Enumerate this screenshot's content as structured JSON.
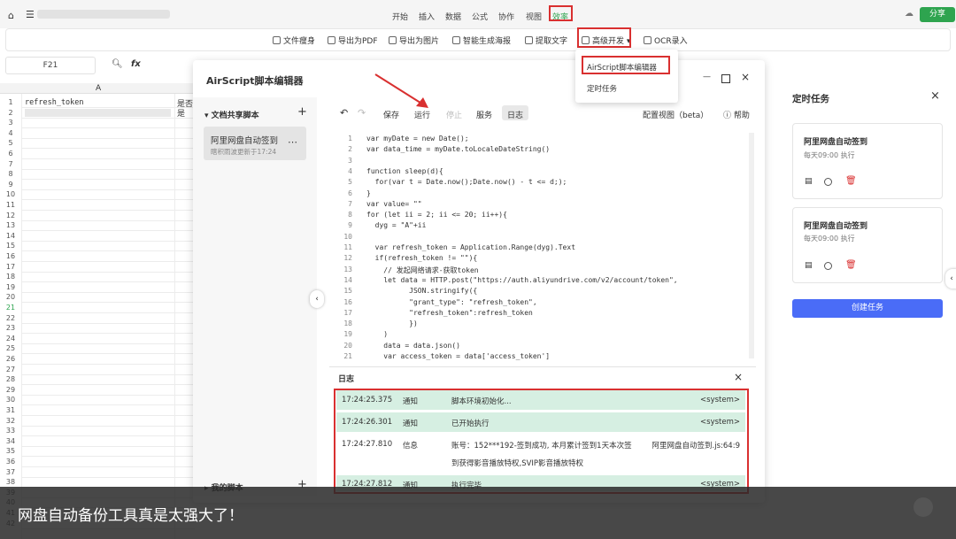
{
  "topbar": {
    "menus": [
      "开始",
      "插入",
      "数据",
      "公式",
      "协作",
      "视图",
      "效率"
    ],
    "share_label": "分享"
  },
  "toolbar": {
    "items": [
      "文件瘦身",
      "导出为PDF",
      "导出为图片",
      "智能生成海报",
      "提取文字",
      "高级开发",
      "OCR录入"
    ]
  },
  "dropdown": {
    "items": [
      "AirScript脚本编辑器",
      "定时任务"
    ]
  },
  "formula": {
    "cell_ref": "F21",
    "fx_label": "fx"
  },
  "sheet": {
    "col_a": "A",
    "a1": "refresh_token",
    "b1": "是否",
    "b2": "是",
    "rows": [
      "1",
      "2",
      "3",
      "4",
      "5",
      "6",
      "7",
      "8",
      "9",
      "10",
      "11",
      "12",
      "13",
      "14",
      "15",
      "16",
      "17",
      "18",
      "19",
      "20",
      "21",
      "22",
      "23",
      "24",
      "25",
      "26",
      "27",
      "28",
      "29",
      "30",
      "31",
      "32",
      "33",
      "34",
      "35",
      "36",
      "37",
      "38",
      "39",
      "40",
      "41",
      "42"
    ]
  },
  "editor": {
    "title": "AirScript脚本编辑器",
    "shared_section": "文档共享脚本",
    "script_name": "阿里网盘自动签到",
    "script_meta": "瞎积雨波更新于17:24",
    "my_scripts": "我的脚本",
    "actions": {
      "save": "保存",
      "run": "运行",
      "stop": "停止",
      "service": "服务",
      "log": "日志"
    },
    "config_view": "配置视图（beta）",
    "help": "帮助",
    "line_numbers": [
      "1",
      "2",
      "3",
      "4",
      "5",
      "6",
      "7",
      "8",
      "9",
      "10",
      "11",
      "12",
      "13",
      "14",
      "15",
      "16",
      "17",
      "18",
      "19",
      "20",
      "21"
    ],
    "code_lines": [
      "var myDate = new Date();",
      "var data_time = myDate.toLocaleDateString()",
      "",
      "function sleep(d){",
      "  for(var t = Date.now();Date.now() - t <= d;);",
      "}",
      "var value= \"\"",
      "for (let ii = 2; ii <= 20; ii++){",
      "  dyg = \"A\"+ii",
      "",
      "  var refresh_token = Application.Range(dyg).Text",
      "  if(refresh_token != \"\"){",
      "    // 发起网络请求-获取token",
      "    let data = HTTP.post(\"https://auth.aliyundrive.com/v2/account/token\",",
      "          JSON.stringify({",
      "          \"grant_type\": \"refresh_token\",",
      "          \"refresh_token\":refresh_token",
      "          })",
      "    )",
      "    data = data.json()",
      "    var access_token = data['access_token']"
    ],
    "log_title": "日志",
    "logs": [
      {
        "time": "17:24:25.375",
        "level": "通知",
        "msg": "脚本环境初始化...",
        "src": "<system>"
      },
      {
        "time": "17:24:26.301",
        "level": "通知",
        "msg": "已开始执行",
        "src": "<system>"
      },
      {
        "time": "17:24:27.810",
        "level": "信息",
        "msg": "账号：152***192-签到成功, 本月累计签到1天本次签",
        "msg2": "到获得影音播放特权,SVIP影音播放特权",
        "src": "阿里网盘自动签到.js:64:9"
      },
      {
        "time": "17:24:27.812",
        "level": "通知",
        "msg": "执行完毕",
        "src": "<system>"
      }
    ]
  },
  "right_panel": {
    "title": "定时任务",
    "tasks": [
      {
        "name": "阿里网盘自动签到",
        "schedule": "每天09:00 执行"
      },
      {
        "name": "阿里网盘自动签到",
        "schedule": "每天09:00 执行"
      }
    ],
    "create_label": "创建任务"
  },
  "caption": "网盘自动备份工具真是太强大了！",
  "colors": {
    "accent": "#4a6cf7",
    "share_green": "#2ea44f",
    "highlight_red": "#d93030",
    "log_green": "#d6efe2"
  }
}
